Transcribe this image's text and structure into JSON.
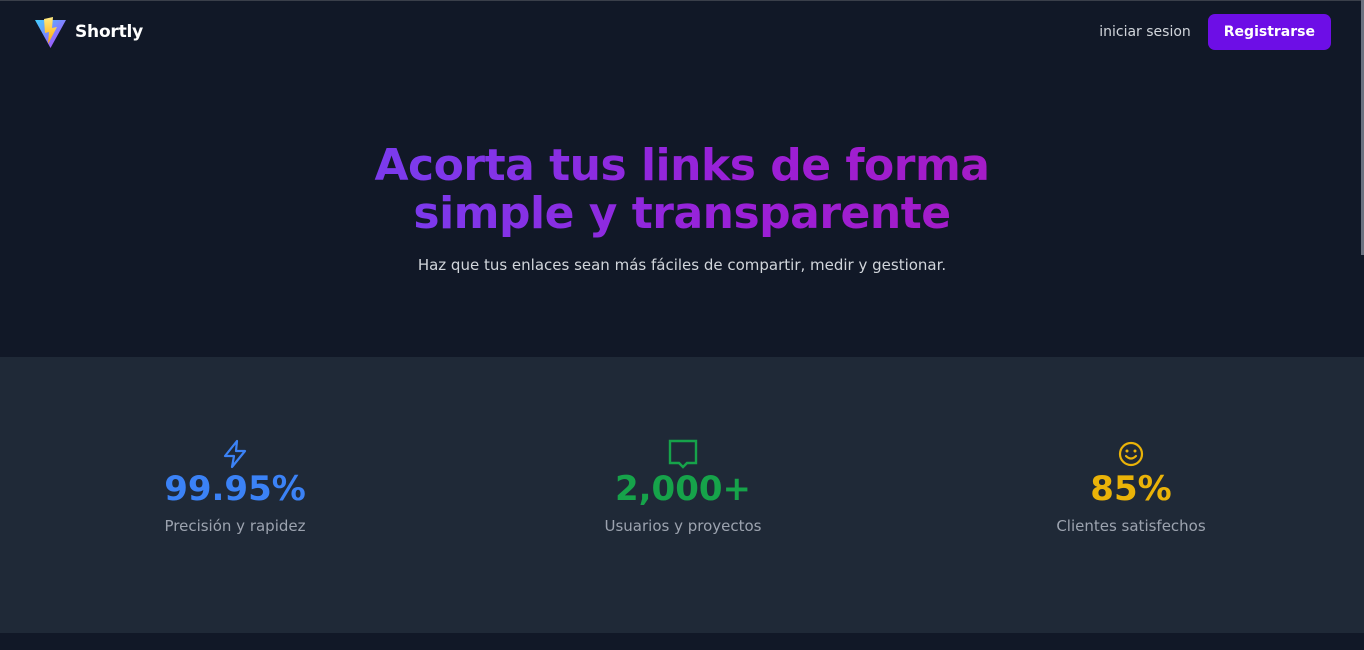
{
  "header": {
    "brand_name": "Shortly",
    "login_label": "iniciar sesion",
    "register_label": "Registrarse"
  },
  "hero": {
    "title_line1": "Acorta tus links de forma",
    "title_line2": "simple y transparente",
    "subtitle": "Haz que tus enlaces sean más fáciles de compartir, medir y gestionar."
  },
  "stats": [
    {
      "icon": "lightning-icon",
      "value": "99.95%",
      "label": "Precisión y rapidez",
      "color": "#3b82f6"
    },
    {
      "icon": "inbox-icon",
      "value": "2,000+",
      "label": "Usuarios y proyectos",
      "color": "#16a34a"
    },
    {
      "icon": "smiley-icon",
      "value": "85%",
      "label": "Clientes satisfechos",
      "color": "#eab308"
    }
  ],
  "colors": {
    "background": "#111827",
    "stats_background": "#1f2937",
    "accent": "#6d0ee6"
  }
}
